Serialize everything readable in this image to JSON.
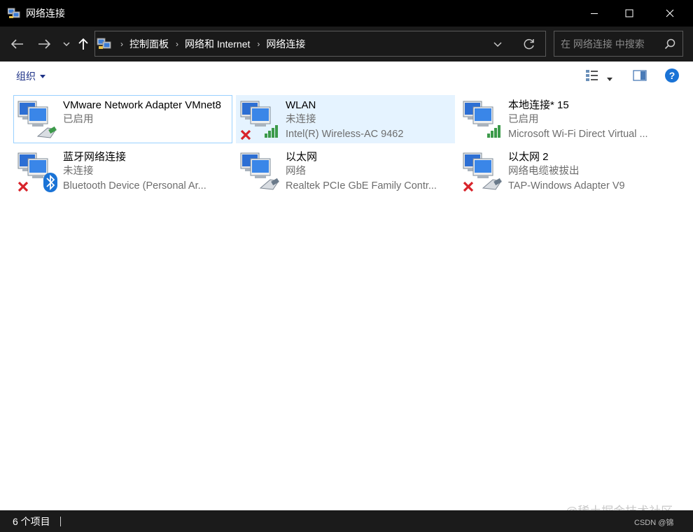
{
  "window": {
    "title": "网络连接"
  },
  "nav": {
    "breadcrumb": [
      "控制面板",
      "网络和 Internet",
      "网络连接"
    ],
    "search_placeholder": "在 网络连接 中搜索"
  },
  "toolbar": {
    "organize_label": "组织"
  },
  "items": [
    {
      "name": "VMware Network Adapter VMnet8",
      "status": "已启用",
      "device": "",
      "icon": "ethernet-adapter-icon",
      "badge": "none"
    },
    {
      "name": "WLAN",
      "status": "未连接",
      "device": "Intel(R) Wireless-AC 9462",
      "icon": "wireless-adapter-icon",
      "badge": "disconnected-x"
    },
    {
      "name": "本地连接* 15",
      "status": "已启用",
      "device": "Microsoft Wi-Fi Direct Virtual ...",
      "icon": "wireless-adapter-icon",
      "badge": "none"
    },
    {
      "name": "蓝牙网络连接",
      "status": "未连接",
      "device": "Bluetooth Device (Personal Ar...",
      "icon": "bluetooth-adapter-icon",
      "badge": "disconnected-x"
    },
    {
      "name": "以太网",
      "status": "网络",
      "device": "Realtek PCIe GbE Family Contr...",
      "icon": "ethernet-adapter-icon",
      "badge": "none"
    },
    {
      "name": "以太网 2",
      "status": "网络电缆被拔出",
      "device": "TAP-Windows Adapter V9",
      "icon": "ethernet-adapter-icon",
      "badge": "disconnected-x"
    }
  ],
  "status": {
    "count": "6 个项目"
  },
  "watermark": {
    "line1": "@稀土掘金技术社区",
    "line2": "CSDN @锦"
  },
  "colors": {
    "selected_bg": "#e5f3ff",
    "focus_border": "#99d1ff",
    "link_blue": "#1e3287",
    "help_blue": "#1a73d6"
  }
}
